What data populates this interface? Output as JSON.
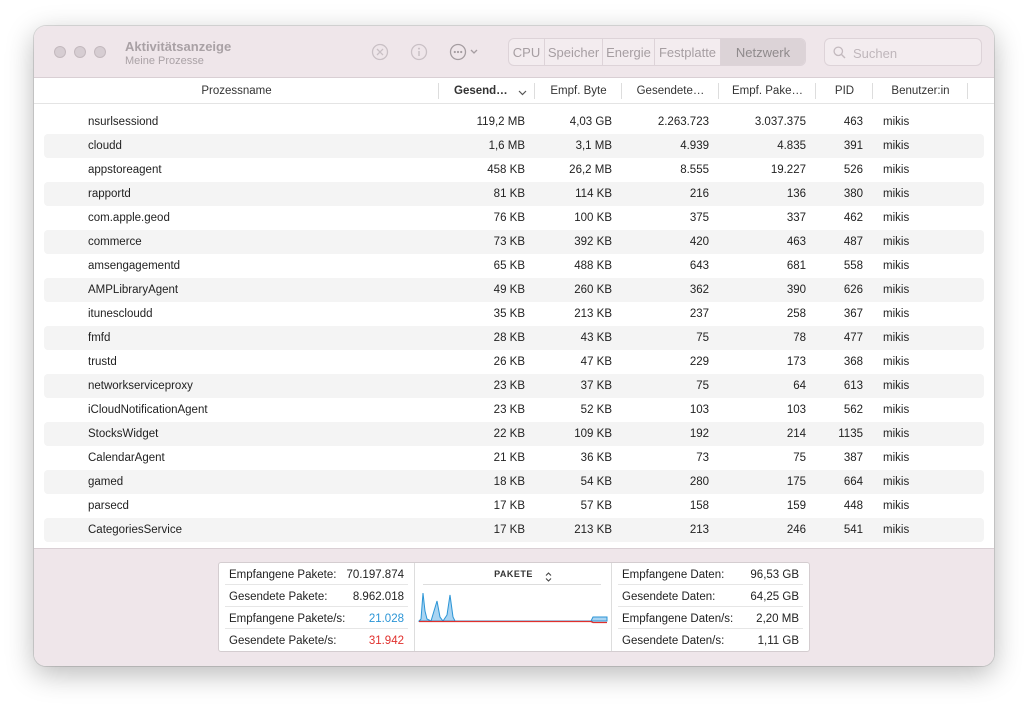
{
  "window": {
    "title": "Aktivitätsanzeige",
    "subtitle": "Meine Prozesse"
  },
  "toolbar": {
    "tabs": [
      {
        "label": "CPU",
        "active": false
      },
      {
        "label": "Speicher",
        "active": false
      },
      {
        "label": "Energie",
        "active": false
      },
      {
        "label": "Festplatte",
        "active": false
      },
      {
        "label": "Netzwerk",
        "active": true
      }
    ],
    "search_placeholder": "Suchen",
    "icons": [
      "stop-process-icon",
      "info-icon",
      "more-options-icon"
    ]
  },
  "table": {
    "columns": [
      "Prozessname",
      "Gesend…",
      "Empf. Byte",
      "Gesendete…",
      "Empf. Pake…",
      "PID",
      "Benutzer:in"
    ],
    "sorted_column": "Gesend…",
    "rows": [
      {
        "name": "nsurlsessiond",
        "sent": "119,2 MB",
        "recv": "4,03 GB",
        "spk": "2.263.723",
        "rpk": "3.037.375",
        "pid": "463",
        "user": "mikis"
      },
      {
        "name": "cloudd",
        "sent": "1,6 MB",
        "recv": "3,1 MB",
        "spk": "4.939",
        "rpk": "4.835",
        "pid": "391",
        "user": "mikis"
      },
      {
        "name": "appstoreagent",
        "sent": "458 KB",
        "recv": "26,2 MB",
        "spk": "8.555",
        "rpk": "19.227",
        "pid": "526",
        "user": "mikis"
      },
      {
        "name": "rapportd",
        "sent": "81 KB",
        "recv": "114 KB",
        "spk": "216",
        "rpk": "136",
        "pid": "380",
        "user": "mikis"
      },
      {
        "name": "com.apple.geod",
        "sent": "76 KB",
        "recv": "100 KB",
        "spk": "375",
        "rpk": "337",
        "pid": "462",
        "user": "mikis"
      },
      {
        "name": "commerce",
        "sent": "73 KB",
        "recv": "392 KB",
        "spk": "420",
        "rpk": "463",
        "pid": "487",
        "user": "mikis"
      },
      {
        "name": "amsengagementd",
        "sent": "65 KB",
        "recv": "488 KB",
        "spk": "643",
        "rpk": "681",
        "pid": "558",
        "user": "mikis"
      },
      {
        "name": "AMPLibraryAgent",
        "sent": "49 KB",
        "recv": "260 KB",
        "spk": "362",
        "rpk": "390",
        "pid": "626",
        "user": "mikis"
      },
      {
        "name": "itunescloudd",
        "sent": "35 KB",
        "recv": "213 KB",
        "spk": "237",
        "rpk": "258",
        "pid": "367",
        "user": "mikis"
      },
      {
        "name": "fmfd",
        "sent": "28 KB",
        "recv": "43 KB",
        "spk": "75",
        "rpk": "78",
        "pid": "477",
        "user": "mikis"
      },
      {
        "name": "trustd",
        "sent": "26 KB",
        "recv": "47 KB",
        "spk": "229",
        "rpk": "173",
        "pid": "368",
        "user": "mikis"
      },
      {
        "name": "networkserviceproxy",
        "sent": "23 KB",
        "recv": "37 KB",
        "spk": "75",
        "rpk": "64",
        "pid": "613",
        "user": "mikis"
      },
      {
        "name": "iCloudNotificationAgent",
        "sent": "23 KB",
        "recv": "52 KB",
        "spk": "103",
        "rpk": "103",
        "pid": "562",
        "user": "mikis"
      },
      {
        "name": "StocksWidget",
        "sent": "22 KB",
        "recv": "109 KB",
        "spk": "192",
        "rpk": "214",
        "pid": "1135",
        "user": "mikis"
      },
      {
        "name": "CalendarAgent",
        "sent": "21 KB",
        "recv": "36 KB",
        "spk": "73",
        "rpk": "75",
        "pid": "387",
        "user": "mikis"
      },
      {
        "name": "gamed",
        "sent": "18 KB",
        "recv": "54 KB",
        "spk": "280",
        "rpk": "175",
        "pid": "664",
        "user": "mikis"
      },
      {
        "name": "parsecd",
        "sent": "17 KB",
        "recv": "57 KB",
        "spk": "158",
        "rpk": "159",
        "pid": "448",
        "user": "mikis"
      },
      {
        "name": "CategoriesService",
        "sent": "17 KB",
        "recv": "213 KB",
        "spk": "213",
        "rpk": "246",
        "pid": "541",
        "user": "mikis"
      }
    ]
  },
  "stats": {
    "left": [
      {
        "label": "Empfangene Pakete:",
        "value": "70.197.874",
        "color": "default"
      },
      {
        "label": "Gesendete Pakete:",
        "value": "8.962.018",
        "color": "default"
      },
      {
        "label": "Empfangene Pakete/s:",
        "value": "21.028",
        "color": "blue"
      },
      {
        "label": "Gesendete Pakete/s:",
        "value": "31.942",
        "color": "red"
      }
    ],
    "right": [
      {
        "label": "Empfangene Daten:",
        "value": "96,53 GB"
      },
      {
        "label": "Gesendete Daten:",
        "value": "64,25 GB"
      },
      {
        "label": "Empfangene Daten/s:",
        "value": "2,20 MB"
      },
      {
        "label": "Gesendete Daten/s:",
        "value": "1,11 GB"
      }
    ],
    "graph_title": "PAKETE",
    "colors": {
      "received": "#2b95d6",
      "sent": "#e0302d"
    }
  }
}
